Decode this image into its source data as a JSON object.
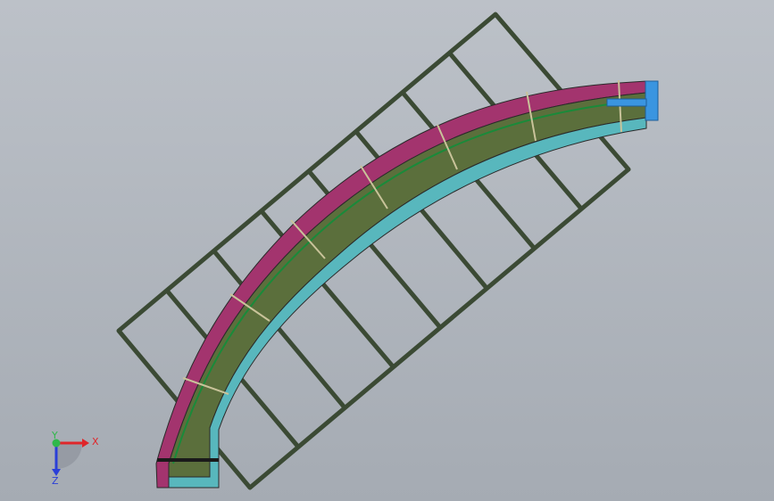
{
  "viewport": {
    "background_top": "#bcc1c8",
    "background_bottom": "#a5abb3"
  },
  "model": {
    "frame_color": "#3b4a34",
    "bed_color": "#5b6f3c",
    "outer_rail_color": "#a3346e",
    "inner_rail_color": "#58b7bd",
    "guide_line_color": "#1a8a3a",
    "end_cap_color": "#3a95e0"
  },
  "triad": {
    "x_label": "X",
    "y_label": "Y",
    "z_label": "Z",
    "x_color": "#e0262a",
    "y_color": "#2fb84a",
    "z_color": "#2a3fd8"
  }
}
